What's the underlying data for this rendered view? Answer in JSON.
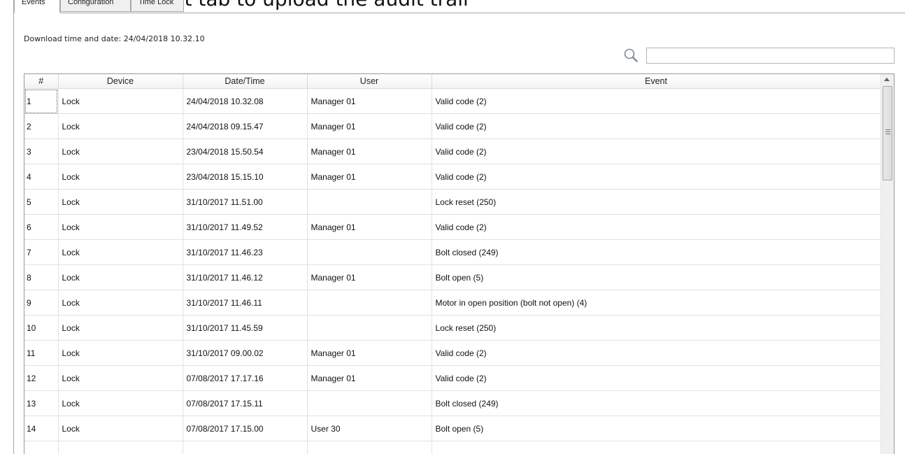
{
  "overlay_caption": "Click on the Event tab to upload the audit trail",
  "tabs": [
    {
      "label": "Events",
      "active": true
    },
    {
      "label": "Configuration",
      "active": false
    },
    {
      "label": "Time Lock",
      "active": false
    }
  ],
  "download": {
    "label": "Download time and date: 24/04/2018 10.32.10"
  },
  "search": {
    "placeholder": "",
    "value": "",
    "icon": "search-icon"
  },
  "table": {
    "columns": [
      "#",
      "Device",
      "Date/Time",
      "User",
      "Event"
    ],
    "rows": [
      {
        "num": "1",
        "device": "Lock",
        "datetime": "24/04/2018 10.32.08",
        "user": "Manager 01",
        "event": "Valid code (2)"
      },
      {
        "num": "2",
        "device": "Lock",
        "datetime": "24/04/2018 09.15.47",
        "user": "Manager 01",
        "event": "Valid code (2)"
      },
      {
        "num": "3",
        "device": "Lock",
        "datetime": "23/04/2018 15.50.54",
        "user": "Manager 01",
        "event": "Valid code (2)"
      },
      {
        "num": "4",
        "device": "Lock",
        "datetime": "23/04/2018 15.15.10",
        "user": "Manager 01",
        "event": "Valid code (2)"
      },
      {
        "num": "5",
        "device": "Lock",
        "datetime": "31/10/2017 11.51.00",
        "user": "",
        "event": "Lock reset (250)"
      },
      {
        "num": "6",
        "device": "Lock",
        "datetime": "31/10/2017 11.49.52",
        "user": "Manager 01",
        "event": "Valid code (2)"
      },
      {
        "num": "7",
        "device": "Lock",
        "datetime": "31/10/2017 11.46.23",
        "user": "",
        "event": "Bolt closed (249)"
      },
      {
        "num": "8",
        "device": "Lock",
        "datetime": "31/10/2017 11.46.12",
        "user": "Manager 01",
        "event": "Bolt open (5)"
      },
      {
        "num": "9",
        "device": "Lock",
        "datetime": "31/10/2017 11.46.11",
        "user": "",
        "event": "Motor in open position (bolt not open) (4)"
      },
      {
        "num": "10",
        "device": "Lock",
        "datetime": "31/10/2017 11.45.59",
        "user": "",
        "event": "Lock reset (250)"
      },
      {
        "num": "11",
        "device": "Lock",
        "datetime": "31/10/2017 09.00.02",
        "user": "Manager 01",
        "event": "Valid code (2)"
      },
      {
        "num": "12",
        "device": "Lock",
        "datetime": "07/08/2017 17.17.16",
        "user": "Manager 01",
        "event": "Valid code (2)"
      },
      {
        "num": "13",
        "device": "Lock",
        "datetime": "07/08/2017 17.15.11",
        "user": "",
        "event": "Bolt closed (249)"
      },
      {
        "num": "14",
        "device": "Lock",
        "datetime": "07/08/2017 17.15.00",
        "user": "User 30",
        "event": "Bolt open (5)"
      },
      {
        "num": "",
        "device": "",
        "datetime": "",
        "user": "",
        "event": ""
      }
    ]
  }
}
